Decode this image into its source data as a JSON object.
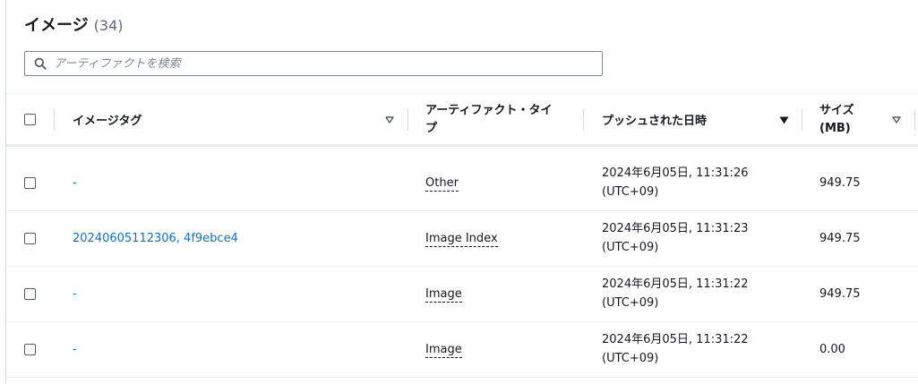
{
  "header": {
    "title": "イメージ",
    "count": "(34)"
  },
  "search": {
    "placeholder": "アーティファクトを検索"
  },
  "table": {
    "columns": {
      "tag": "イメージタグ",
      "artifact_type_line1": "アーティファクト・タイ",
      "artifact_type_line2": "プ",
      "pushed": "プッシュされた日時",
      "size_line1": "サイズ",
      "size_line2": "(MB)"
    },
    "rows": [
      {
        "tag": "-",
        "artifact_type": "Other",
        "pushed_line1": "2024年6月05日, 11:31:26",
        "pushed_line2": "(UTC+09)",
        "size": "949.75"
      },
      {
        "tag": "20240605112306, 4f9ebce4",
        "artifact_type": "Image Index",
        "pushed_line1": "2024年6月05日, 11:31:23",
        "pushed_line2": "(UTC+09)",
        "size": "949.75"
      },
      {
        "tag": "-",
        "artifact_type": "Image",
        "pushed_line1": "2024年6月05日, 11:31:22",
        "pushed_line2": "(UTC+09)",
        "size": "949.75"
      },
      {
        "tag": "-",
        "artifact_type": "Image",
        "pushed_line1": "2024年6月05日, 11:31:22",
        "pushed_line2": "(UTC+09)",
        "size": "0.00"
      }
    ]
  },
  "icons": {
    "search": "search-icon",
    "sort_neutral": "caret-down-outline-icon",
    "sort_active": "caret-down-filled-icon"
  },
  "colors": {
    "link": "#0972d3",
    "text": "#16191f",
    "muted": "#5f6b7a",
    "border": "#eaeded"
  }
}
